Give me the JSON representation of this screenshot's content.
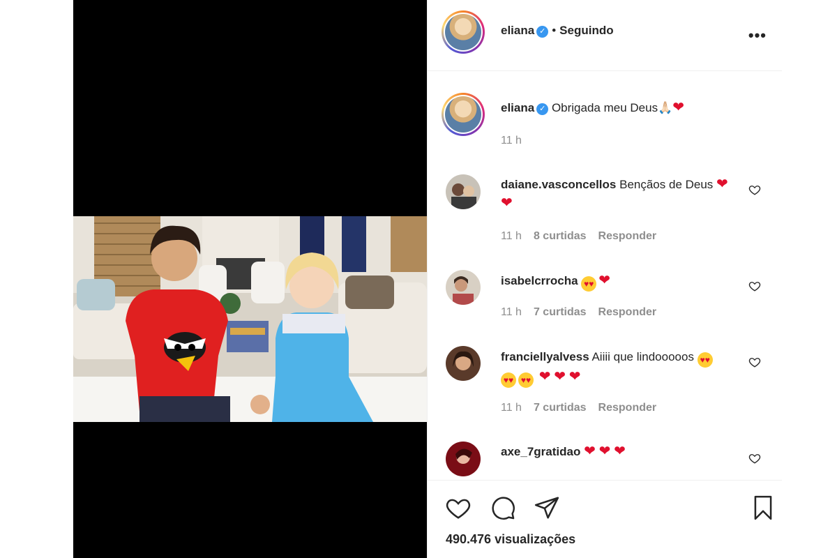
{
  "post": {
    "author": "eliana",
    "follow_status": "Seguindo",
    "separator": "•",
    "more_label": "•••",
    "caption": {
      "username": "eliana",
      "text": "Obrigada meu Deus🙏🏻",
      "time": "11 h"
    },
    "comments": [
      {
        "username": "daiane.vasconcellos",
        "text": "Bençãos de Deus",
        "hearts": 2,
        "faces": 0,
        "time": "11 h",
        "likes": "8 curtidas",
        "reply": "Responder"
      },
      {
        "username": "isabelcrrocha",
        "text": "",
        "hearts": 1,
        "faces": 1,
        "time": "11 h",
        "likes": "7 curtidas",
        "reply": "Responder"
      },
      {
        "username": "franciellyalvess",
        "text": "Aiiii que lindooooos",
        "hearts": 3,
        "faces": 3,
        "time": "11 h",
        "likes": "7 curtidas",
        "reply": "Responder"
      },
      {
        "username": "axe_7gratidao",
        "text": "",
        "hearts": 3,
        "faces": 0
      }
    ],
    "views": "490.476 visualizações"
  },
  "colors": {
    "verified": "#3897f0",
    "heart": "#e0102e",
    "meta_gray": "#8e8e8e",
    "text": "#262626"
  },
  "icons": {
    "like": "heart-icon",
    "comment": "comment-icon",
    "share": "paper-plane-icon",
    "save": "bookmark-icon",
    "more": "more-options-icon"
  }
}
